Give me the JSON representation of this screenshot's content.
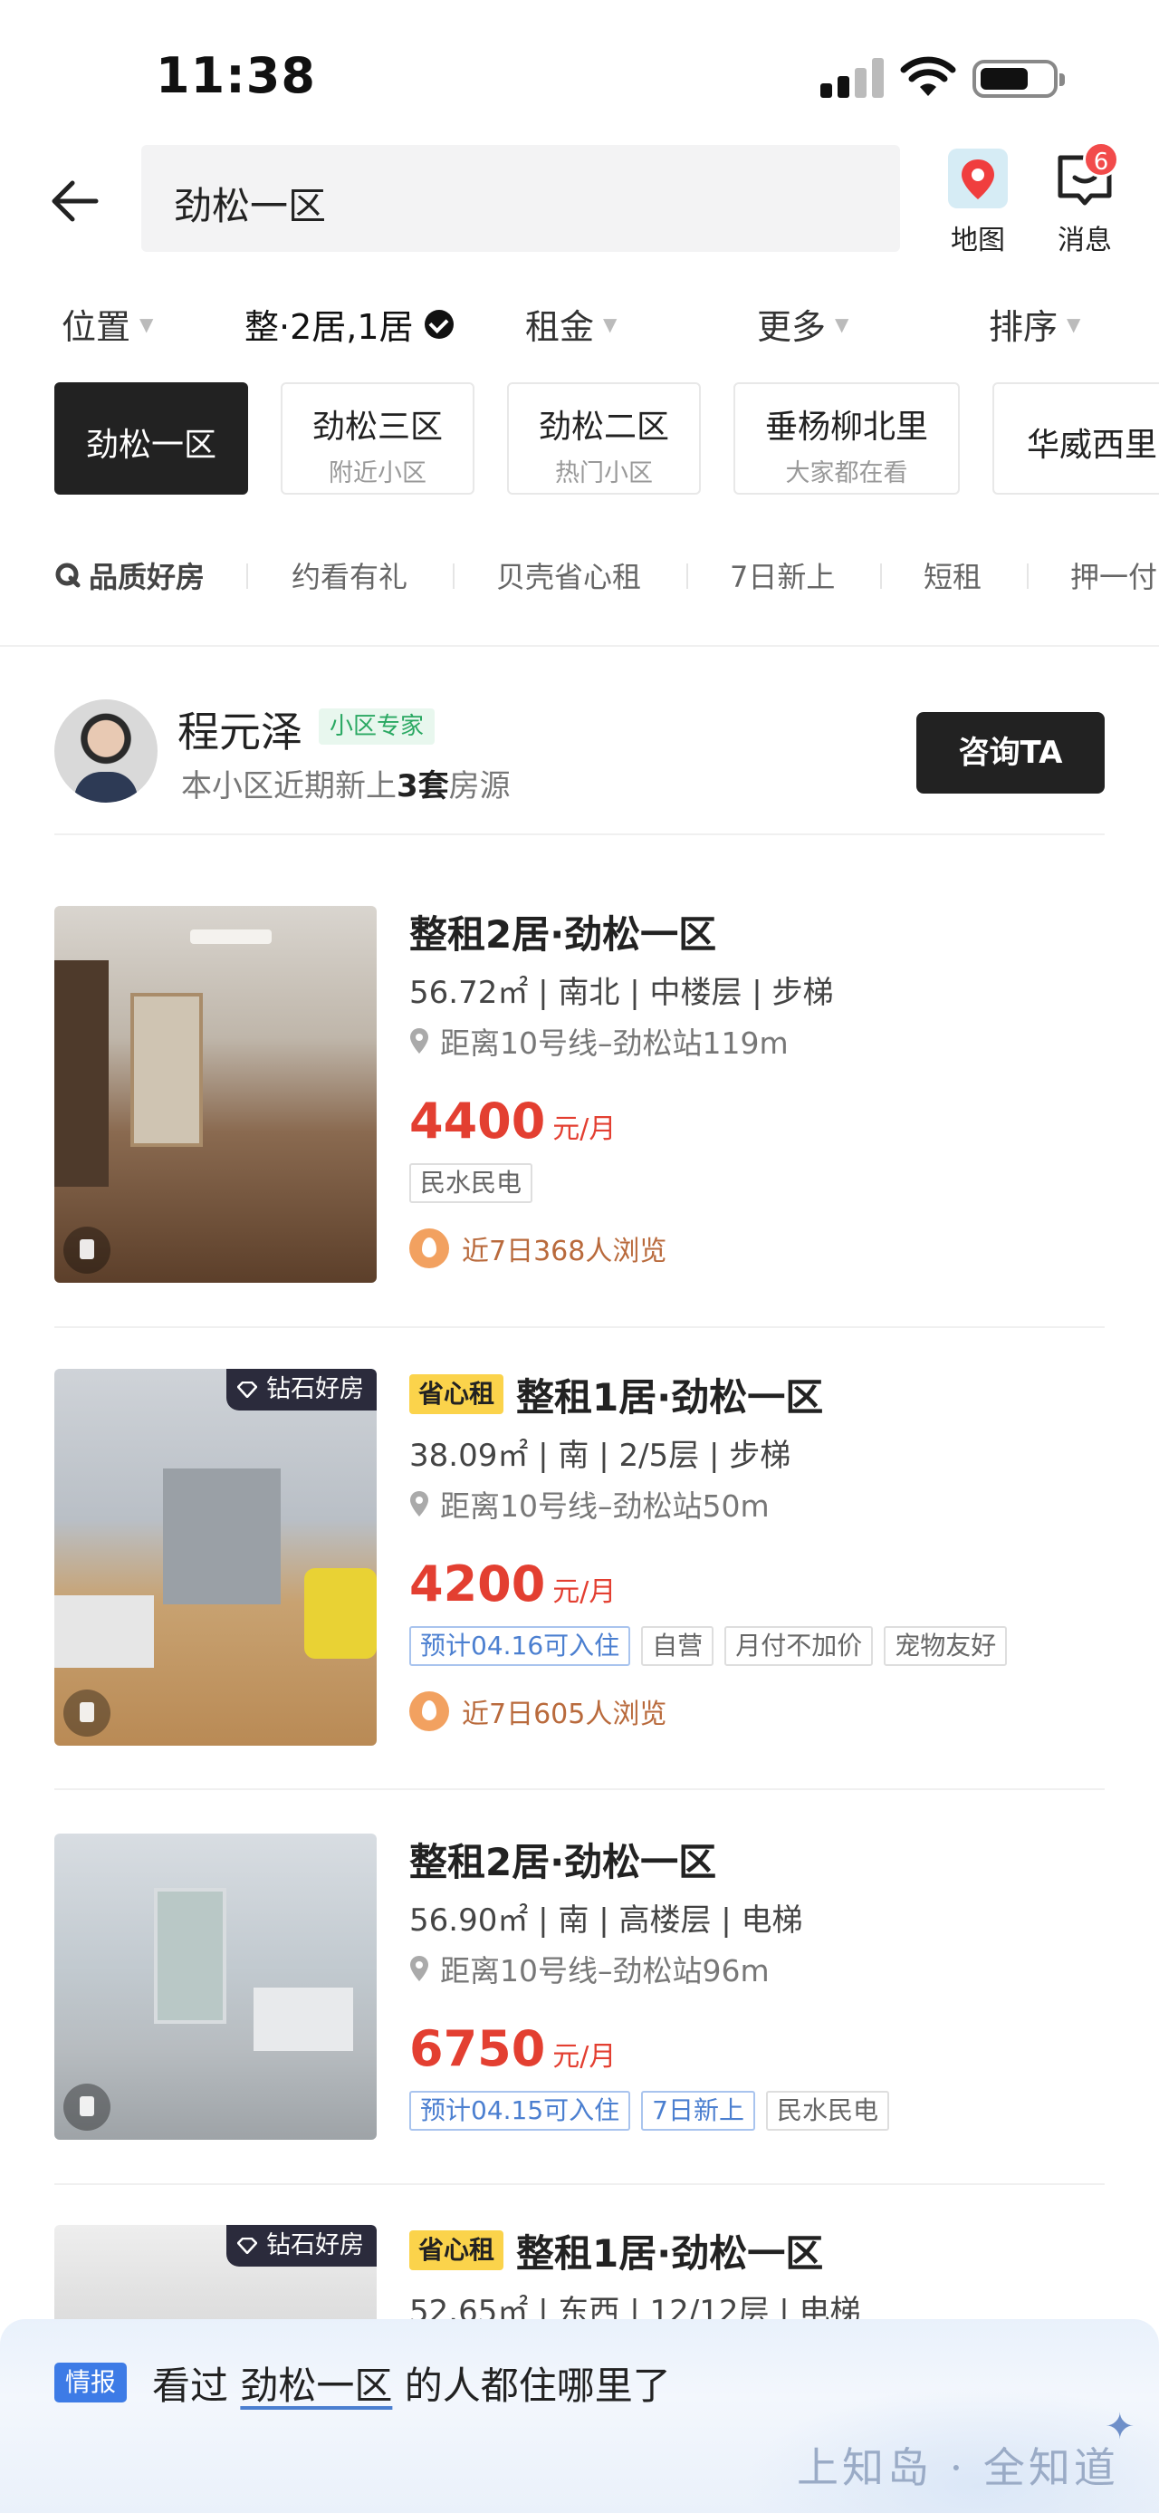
{
  "status_bar": {
    "time": "11:38"
  },
  "header": {
    "search_value": "劲松一区",
    "map_label": "地图",
    "message_label": "消息",
    "message_badge": "6"
  },
  "filters": [
    {
      "label": "位置",
      "active": false
    },
    {
      "label": "整·2居,1居",
      "active": true
    },
    {
      "label": "租金",
      "active": false
    },
    {
      "label": "更多",
      "active": false
    },
    {
      "label": "排序",
      "active": false
    }
  ],
  "community_chips": [
    {
      "name": "劲松一区",
      "sub": ""
    },
    {
      "name": "劲松三区",
      "sub": "附近小区"
    },
    {
      "name": "劲松二区",
      "sub": "热门小区"
    },
    {
      "name": "垂杨柳北里",
      "sub": "大家都在看"
    },
    {
      "name": "华威西里",
      "sub": ""
    }
  ],
  "tags": [
    "品质好房",
    "约看有礼",
    "贝壳省心租",
    "7日新上",
    "短租",
    "押一付"
  ],
  "agent": {
    "name": "程元泽",
    "badge": "小区专家",
    "desc_prefix": "本小区近期新上",
    "desc_count": "3套",
    "desc_suffix": "房源",
    "button": "咨询TA"
  },
  "listings": [
    {
      "title": "整租2居·劲松一区",
      "meta": "56.72㎡ | 南北 | 中楼层 | 步梯",
      "distance": "距离10号线–劲松站119m",
      "price": "4400",
      "unit": "元/月",
      "labels": [
        "民水民电"
      ],
      "views": "近7日368人浏览"
    },
    {
      "badge": "钻石好房",
      "tag": "省心租",
      "title": "整租1居·劲松一区",
      "meta": "38.09㎡ | 南 | 2/5层 | 步梯",
      "distance": "距离10号线–劲松站50m",
      "price": "4200",
      "unit": "元/月",
      "labels": [
        "预计04.16可入住",
        "自营",
        "月付不加价",
        "宠物友好"
      ],
      "views": "近7日605人浏览"
    },
    {
      "title": "整租2居·劲松一区",
      "meta": "56.90㎡ | 南 | 高楼层 | 电梯",
      "distance": "距离10号线–劲松站96m",
      "price": "6750",
      "unit": "元/月",
      "labels": [
        "预计04.15可入住",
        "7日新上",
        "民水民电"
      ]
    },
    {
      "badge": "钻石好房",
      "tag": "省心租",
      "title": "整租1居·劲松一区",
      "meta": "52.65㎡ | 东西 | 12/12层 | 电梯"
    }
  ],
  "banner": {
    "badge": "情报",
    "text_prefix": "看过 ",
    "text_link": "劲松一区",
    "text_suffix": " 的人都住哪里了",
    "watermark": "上知岛 · 全知道"
  }
}
